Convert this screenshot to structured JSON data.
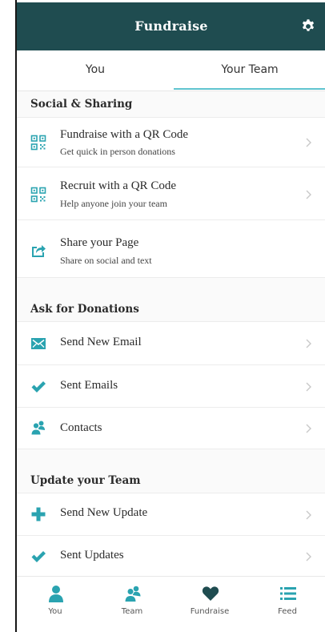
{
  "header": {
    "title": "Fundraise",
    "settings_icon": "gear-icon"
  },
  "tabs": [
    {
      "label": "You",
      "selected": false
    },
    {
      "label": "Your Team",
      "selected": true
    }
  ],
  "sections": {
    "social": {
      "title": "Social & Sharing",
      "items": [
        {
          "title": "Fundraise with a QR Code",
          "subtitle": "Get quick in person donations",
          "icon": "qr-code-icon"
        },
        {
          "title": "Recruit with a QR Code",
          "subtitle": "Help anyone join your team",
          "icon": "qr-code-icon"
        },
        {
          "title": "Share your Page",
          "subtitle": "Share on social and text",
          "icon": "share-icon"
        }
      ]
    },
    "ask": {
      "title": "Ask for Donations",
      "items": [
        {
          "title": "Send New Email",
          "icon": "envelope-icon"
        },
        {
          "title": "Sent Emails",
          "icon": "checkmark-icon"
        },
        {
          "title": "Contacts",
          "icon": "contacts-icon"
        }
      ]
    },
    "update": {
      "title": "Update your Team",
      "items": [
        {
          "title": "Send New Update",
          "icon": "plus-icon"
        },
        {
          "title": "Sent Updates",
          "icon": "checkmark-icon"
        }
      ]
    }
  },
  "bottom_nav": [
    {
      "label": "You",
      "icon": "person-icon"
    },
    {
      "label": "Team",
      "icon": "team-icon"
    },
    {
      "label": "Fundraise",
      "icon": "heart-icon"
    },
    {
      "label": "Feed",
      "icon": "list-icon"
    }
  ],
  "colors": {
    "header_bg": "#1f4c50",
    "accent": "#2fa8b5",
    "tab_indicator": "#5fc4cf",
    "icon_teal": "#2aa3b0"
  }
}
